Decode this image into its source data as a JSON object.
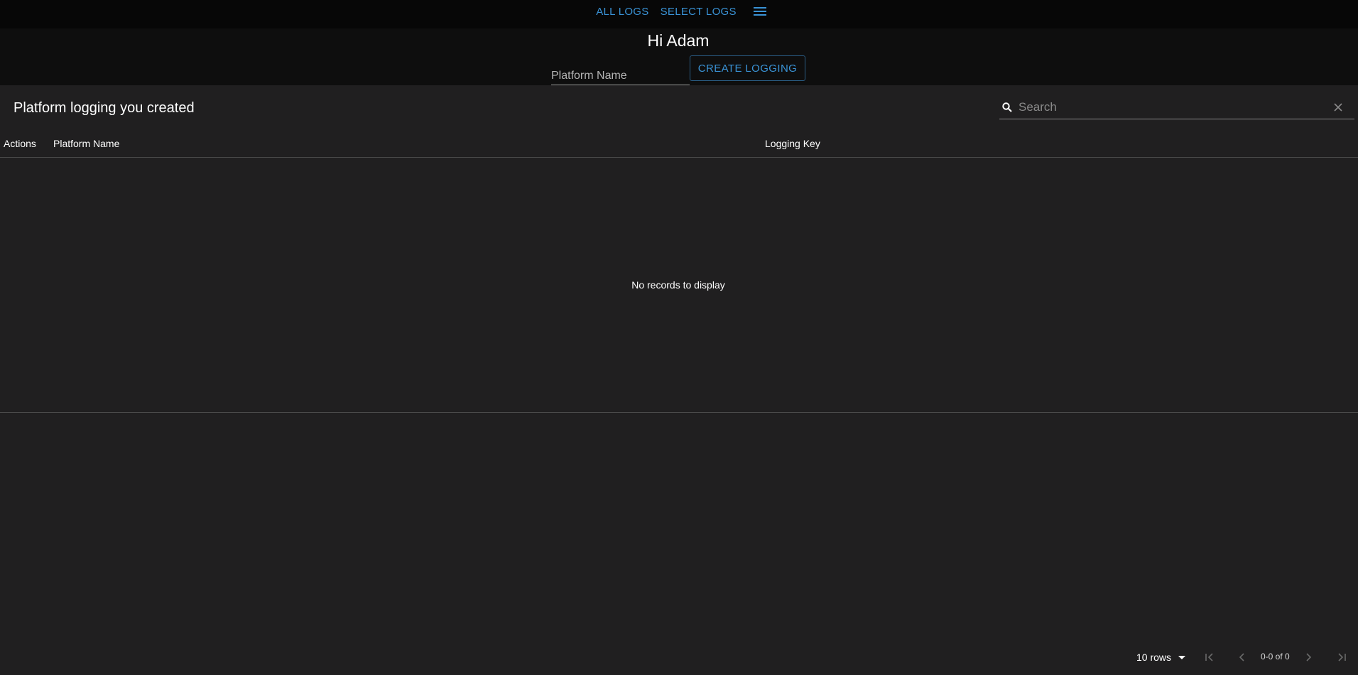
{
  "nav": {
    "all_logs": "ALL LOGS",
    "select_logs": "SELECT LOGS",
    "menu_icon": "menu-icon"
  },
  "header": {
    "greeting": "Hi Adam",
    "platform_placeholder": "Platform Name",
    "create_label": "CREATE LOGGING"
  },
  "panel": {
    "title": "Platform logging you created",
    "search_placeholder": "Search",
    "columns": [
      "Actions",
      "Platform Name",
      "Logging Key"
    ],
    "empty_message": "No records to display"
  },
  "pager": {
    "rows_label": "10 rows",
    "range": "0-0 of 0"
  },
  "colors": {
    "accent": "#3a93d6",
    "background": "#201f20",
    "topbar": "#070707"
  }
}
